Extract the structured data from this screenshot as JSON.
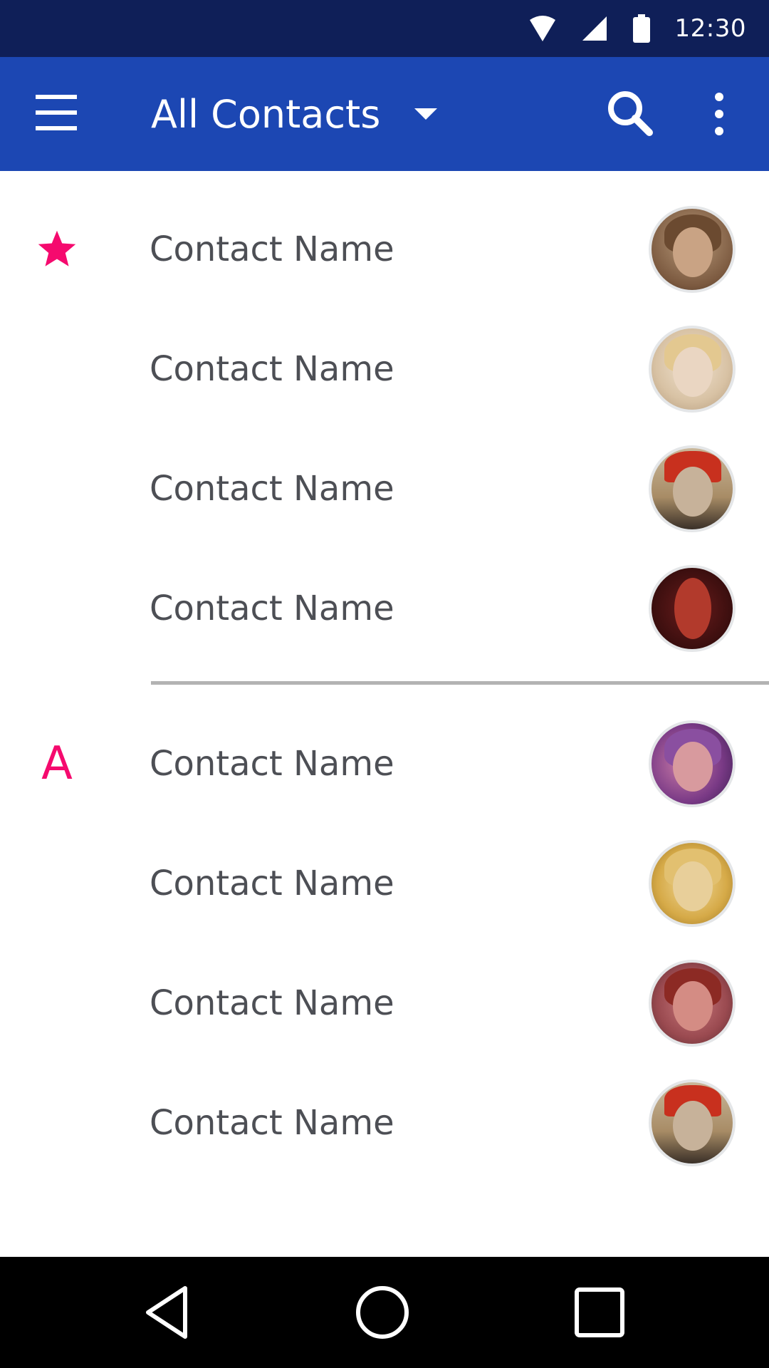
{
  "status_bar": {
    "time": "12:30",
    "icons": [
      "wifi-icon",
      "cell-signal-icon",
      "battery-icon"
    ]
  },
  "app_bar": {
    "title": "All Contacts",
    "icons": [
      "menu-icon",
      "dropdown-caret-icon",
      "search-icon",
      "more-vert-icon"
    ],
    "color": "#1c47b3"
  },
  "colors": {
    "status_bar": "#0f1f58",
    "accent": "#f50a6e",
    "name_text": "#4d4f55"
  },
  "sections": [
    {
      "header_icon": "star-icon",
      "header_label": "",
      "contacts": [
        {
          "name": "Contact Name",
          "avatar": "avatar-woman-horns"
        },
        {
          "name": "Contact Name",
          "avatar": "avatar-woman-blonde"
        },
        {
          "name": "Contact Name",
          "avatar": "avatar-man-red-fez"
        },
        {
          "name": "Contact Name",
          "avatar": "avatar-red-face-headphones"
        }
      ]
    },
    {
      "header_icon": "",
      "header_label": "A",
      "contacts": [
        {
          "name": "Contact Name",
          "avatar": "avatar-woman-purple-headphones"
        },
        {
          "name": "Contact Name",
          "avatar": "avatar-golden-face"
        },
        {
          "name": "Contact Name",
          "avatar": "avatar-woman-red-hair"
        },
        {
          "name": "Contact Name",
          "avatar": "avatar-man-red-fez"
        }
      ]
    }
  ],
  "nav_bar": {
    "icons": [
      "back-icon",
      "home-icon",
      "recents-icon"
    ]
  }
}
